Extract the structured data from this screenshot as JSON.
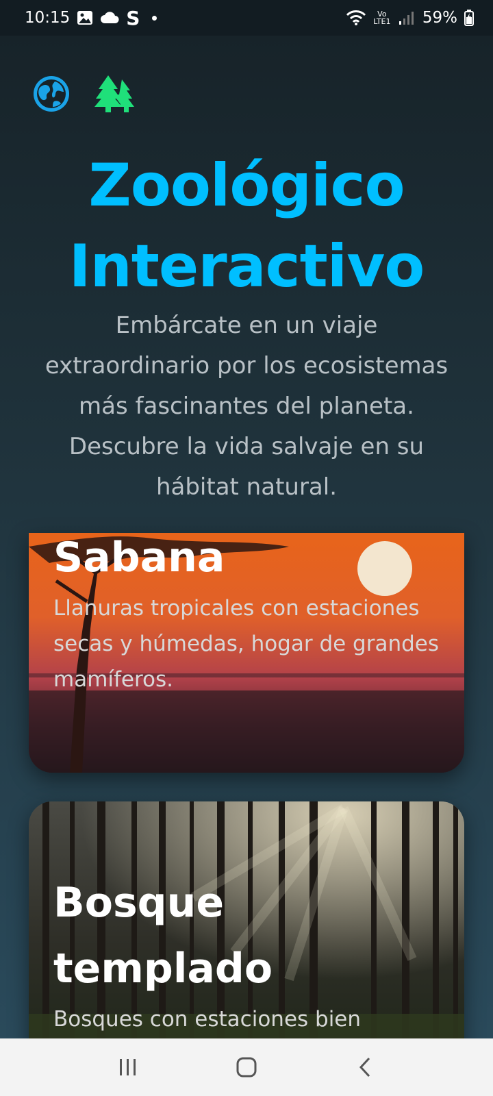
{
  "status_bar": {
    "time": "10:15",
    "letter": "S",
    "network": "Vo LTE1",
    "battery": "59%"
  },
  "header": {
    "icons": [
      "globe-icon",
      "trees-icon"
    ],
    "icon_colors": {
      "globe": "#1aa3e8",
      "trees": "#1fe07a"
    },
    "title_line1": "Zoológico",
    "title_line2": "Interactivo",
    "subtitle": "Embárcate en un viaje extraordinario por los ecosistemas más fascinantes del planeta. Descubre la vida salvaje en su hábitat natural."
  },
  "habitats": [
    {
      "title": "Sabana",
      "description": "Llanuras tropicales con estaciones secas y húmedas, hogar de grandes mamíferos."
    },
    {
      "title_line1": "Bosque",
      "title_line2": "templado",
      "description": "Bosques con estaciones bien"
    }
  ],
  "nav": {
    "buttons": [
      "recents-button",
      "home-button",
      "back-button"
    ]
  },
  "colors": {
    "accent": "#00bfff",
    "background": "#1f323b"
  }
}
